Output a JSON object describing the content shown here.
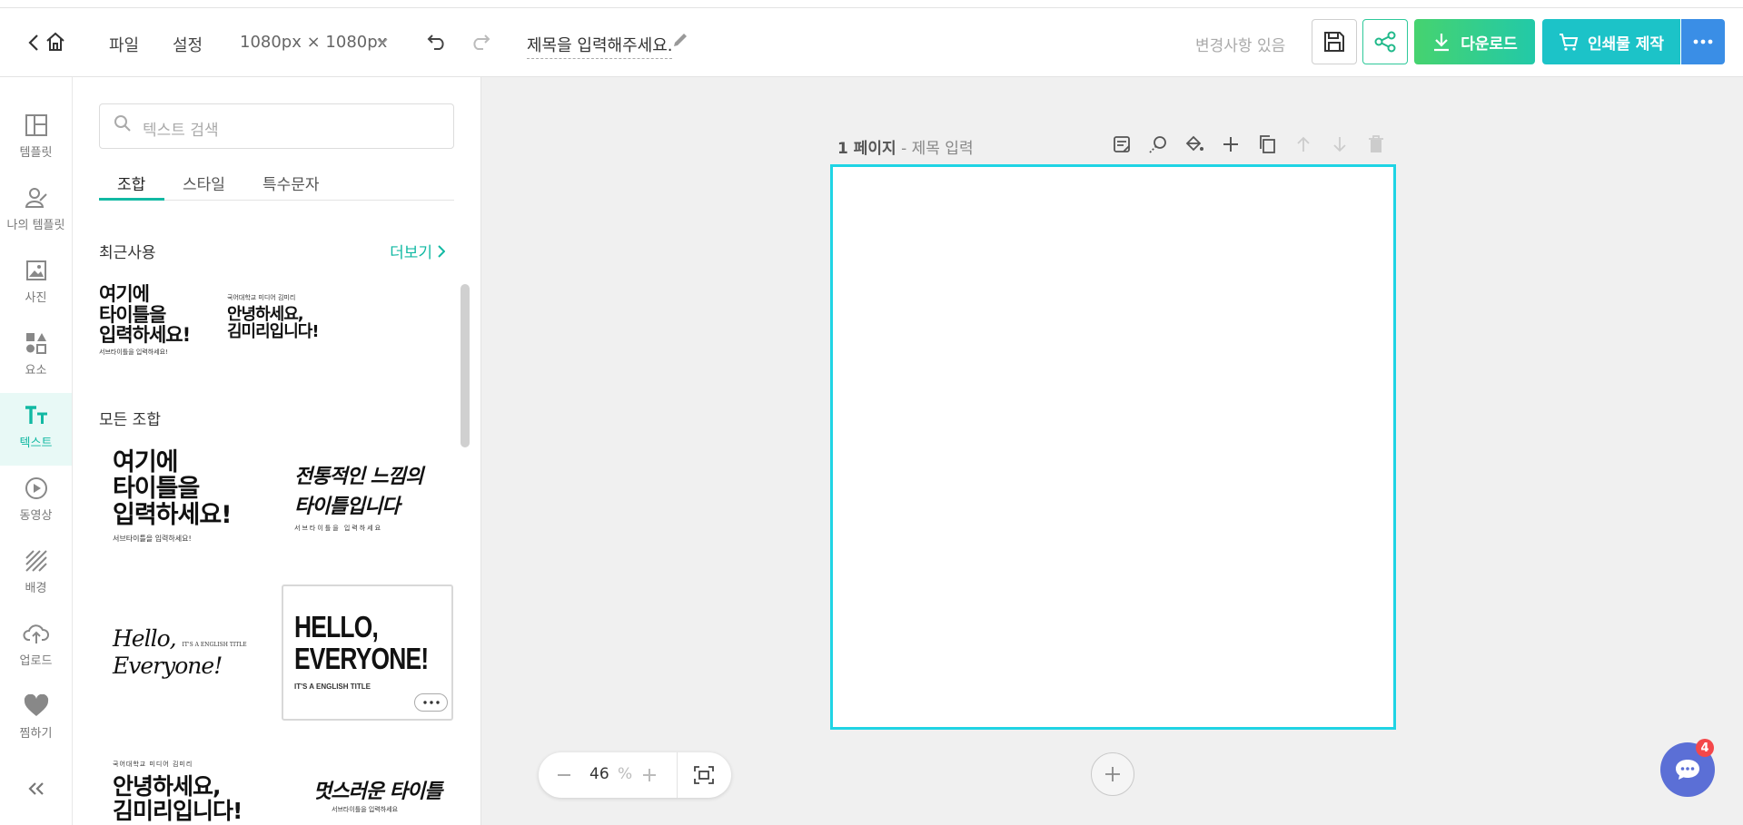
{
  "topbar": {
    "file_label": "파일",
    "settings_label": "설정",
    "canvas_size": "1080px × 1080px",
    "title_placeholder": "제목을 입력해주세요.",
    "change_status": "변경사항 있음",
    "download_label": "다운로드",
    "print_label": "인쇄물 제작"
  },
  "rail": {
    "items": [
      {
        "label": "템플릿",
        "icon": "template-icon"
      },
      {
        "label": "나의 템플릿",
        "icon": "my-template-icon"
      },
      {
        "label": "사진",
        "icon": "photo-icon"
      },
      {
        "label": "요소",
        "icon": "elements-icon"
      },
      {
        "label": "텍스트",
        "icon": "text-icon"
      },
      {
        "label": "동영상",
        "icon": "video-icon"
      },
      {
        "label": "배경",
        "icon": "background-icon"
      },
      {
        "label": "업로드",
        "icon": "upload-icon"
      },
      {
        "label": "찜하기",
        "icon": "heart-icon"
      }
    ],
    "active": "텍스트"
  },
  "panel": {
    "search_placeholder": "텍스트 검색",
    "tabs": [
      "조합",
      "스타일",
      "특수문자"
    ],
    "active_tab": "조합",
    "recent_label": "최근사용",
    "more_label": "더보기",
    "all_label": "모든 조합",
    "recent_items": [
      {
        "lines": [
          "여기에",
          "타이틀을",
          "입력하세요!"
        ],
        "sub": "서브타이틀을 입력하세요!"
      },
      {
        "top": "국어대학교 미디어 김미리",
        "lines": [
          "안녕하세요,",
          "김미리입니다!"
        ]
      }
    ],
    "all_items": [
      {
        "lines": [
          "여기에",
          "타이틀을",
          "입력하세요!"
        ],
        "sub": "서브타이틀을 입력하세요!"
      },
      {
        "lines": [
          "전통적인 느낌의",
          "타이틀입니다"
        ],
        "sub": "서브타이틀을 입력하세요"
      },
      {
        "lines": [
          "Hello,",
          "Everyone!"
        ],
        "sub": "IT'S A ENGLISH TITLE"
      },
      {
        "lines": [
          "HELLO,",
          "EVERYONE!"
        ],
        "sub": "IT'S A ENGLISH TITLE"
      },
      {
        "top": "국어대학교 미디어 김미리",
        "lines": [
          "안녕하세요,",
          "김미리입니다!"
        ]
      },
      {
        "lines": [
          "멋스러운 타이틀"
        ],
        "sub": "서브타이틀을 입력하세요"
      }
    ]
  },
  "canvas": {
    "page_number": "1 페이지",
    "page_title": "- 제목 입력",
    "zoom_value": "46",
    "zoom_unit": "%"
  },
  "chat": {
    "badge": "4"
  },
  "colors": {
    "accent": "#12b9a3",
    "download": "#2ed08a",
    "print": "#1cc3c8",
    "more": "#3a8ee6",
    "page_border": "#1fd4e4"
  }
}
